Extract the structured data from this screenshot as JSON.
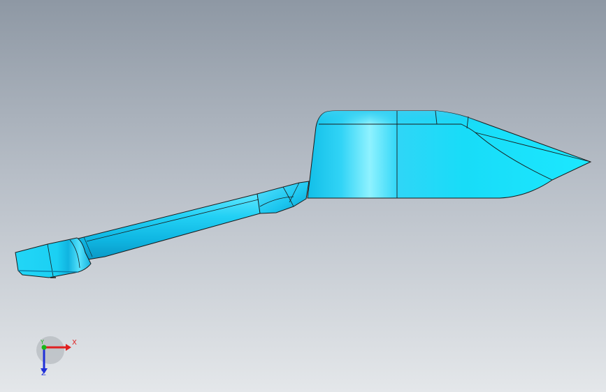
{
  "viewport": {
    "background_top": "#8e98a4",
    "background_bottom": "#e4e7ea"
  },
  "model": {
    "fill_color": "#18d6f5",
    "highlight_color": "#8ff2ff",
    "shadow_color": "#0a9fca",
    "edge_color": "#1a1a1a"
  },
  "triad": {
    "x_label": "X",
    "y_label": "Y",
    "z_label": "Z",
    "x_color": "#e02020",
    "y_color": "#18b818",
    "z_color": "#2030d8"
  }
}
